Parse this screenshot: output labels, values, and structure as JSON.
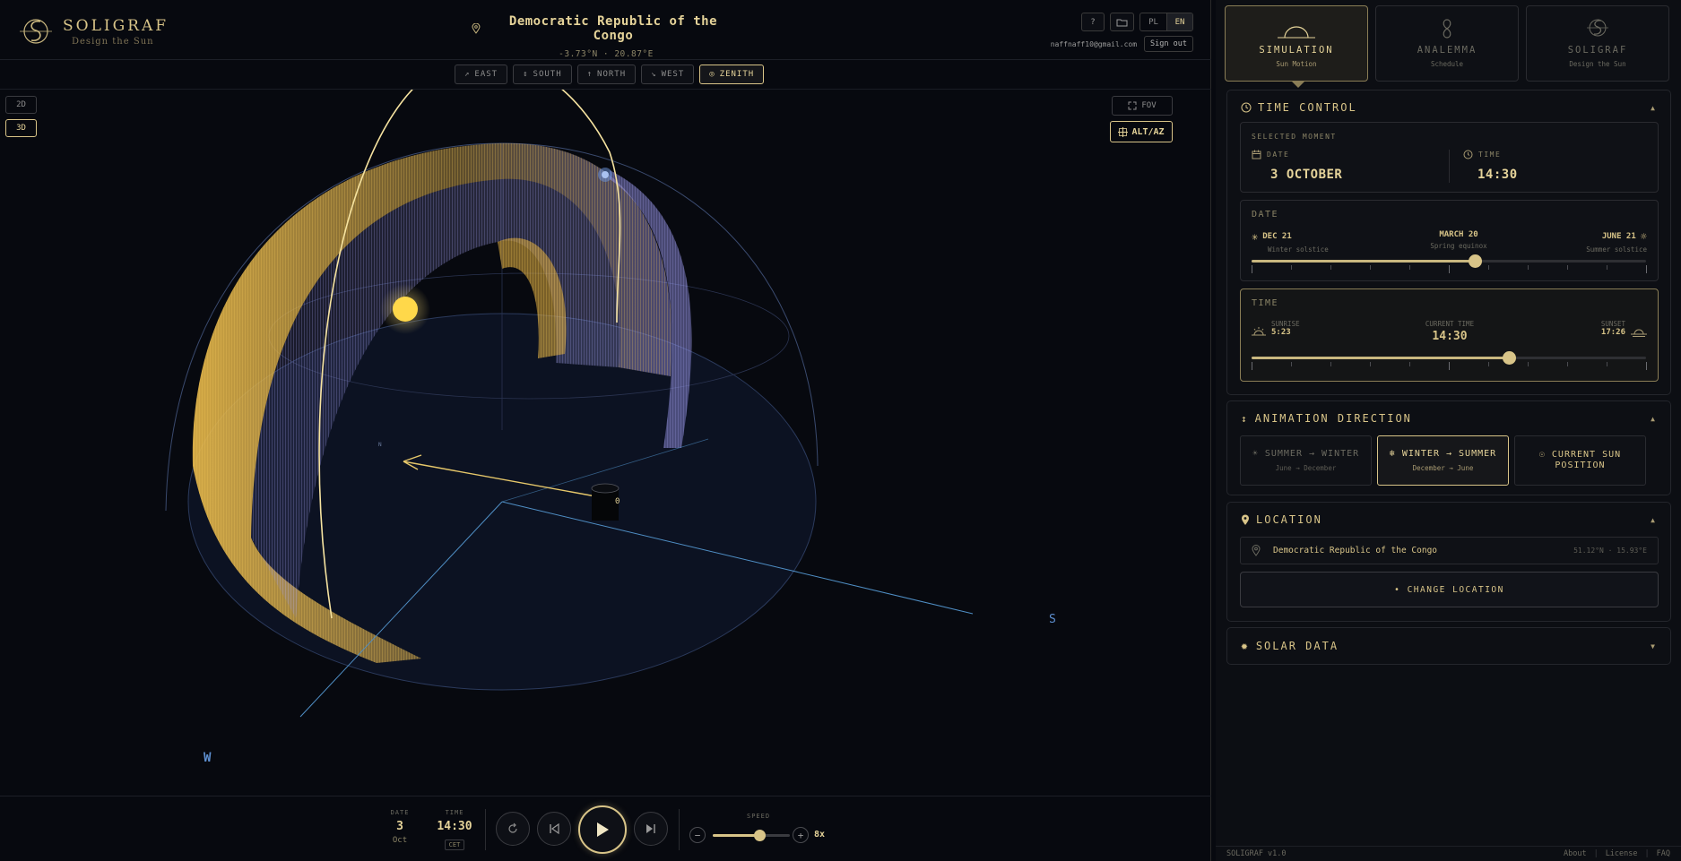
{
  "app": {
    "name": "SOLIGRAF",
    "tagline": "Design the Sun",
    "version": "SOLIGRAF v1.0"
  },
  "location_header": {
    "title": "Democratic Republic of the Congo",
    "coords": "-3.73°N · 20.87°E"
  },
  "top_controls": {
    "help": "?",
    "languages": [
      "PL",
      "EN"
    ],
    "active_language": "EN",
    "user_email": "naffnaff10@gmail.com",
    "sign_out": "Sign out"
  },
  "view_directions": [
    {
      "icon": "↗",
      "label": "EAST",
      "active": false
    },
    {
      "icon": "↕",
      "label": "SOUTH",
      "active": false
    },
    {
      "icon": "↑",
      "label": "NORTH",
      "active": false
    },
    {
      "icon": "↘",
      "label": "WEST",
      "active": false
    },
    {
      "icon": "◎",
      "label": "ZENITH",
      "active": true
    }
  ],
  "view_modes": {
    "two_d": "2D",
    "three_d": "3D",
    "active": "3D"
  },
  "scene_controls": {
    "fov": "FOV",
    "altaz": "ALT/AZ"
  },
  "scene_labels": {
    "south": "S",
    "west": "W",
    "origin": "0",
    "north_small": "N"
  },
  "playback": {
    "date_label": "DATE",
    "day": "3",
    "month": "Oct",
    "time_label": "TIME",
    "time": "14:30",
    "timezone": "CET",
    "speed_label": "SPEED",
    "speed_value": "8x",
    "speed_fraction": 0.6
  },
  "mode_tabs": [
    {
      "title": "SIMULATION",
      "subtitle": "Sun Motion",
      "active": true
    },
    {
      "title": "ANALEMMA",
      "subtitle": "Schedule",
      "active": false
    },
    {
      "title": "SOLIGRAF",
      "subtitle": "Design the Sun",
      "active": false
    }
  ],
  "time_control": {
    "title": "TIME CONTROL",
    "selected_moment_label": "SELECTED MOMENT",
    "date_label": "DATE",
    "date_value": "3 OCTOBER",
    "time_label": "TIME",
    "time_value": "14:30",
    "date_slider": {
      "title": "DATE",
      "left": {
        "label": "DEC 21",
        "sub": "Winter solstice"
      },
      "mid": {
        "label": "MARCH 20",
        "sub": "Spring equinox"
      },
      "right": {
        "label": "JUNE 21",
        "sub": "Summer solstice"
      },
      "fraction": 0.565
    },
    "time_slider": {
      "title": "TIME",
      "sunrise_label": "SUNRISE",
      "sunrise": "5:23",
      "current_label": "CURRENT TIME",
      "current": "14:30",
      "sunset_label": "SUNSET",
      "sunset": "17:26",
      "fraction": 0.652
    }
  },
  "animation_direction": {
    "title": "ANIMATION DIRECTION",
    "options": [
      {
        "title": "☀ SUMMER → WINTER",
        "sub": "June → December",
        "active": false
      },
      {
        "title": "❄ WINTER → SUMMER",
        "sub": "December → June",
        "active": true
      },
      {
        "title": "☉ CURRENT SUN POSITION",
        "sub": "",
        "active": false
      }
    ]
  },
  "location": {
    "title": "LOCATION",
    "name": "Democratic Republic of the Congo",
    "coords": "51.12°N · 15.93°E",
    "change_button": "• CHANGE LOCATION"
  },
  "solar_data": {
    "title": "SOLAR DATA"
  },
  "footer": {
    "links": [
      "About",
      "License",
      "FAQ"
    ]
  },
  "colors": {
    "gold": "#d8c488",
    "accent": "#e6d49a",
    "background": "#07090f",
    "lavender": "#a9a6f0"
  }
}
